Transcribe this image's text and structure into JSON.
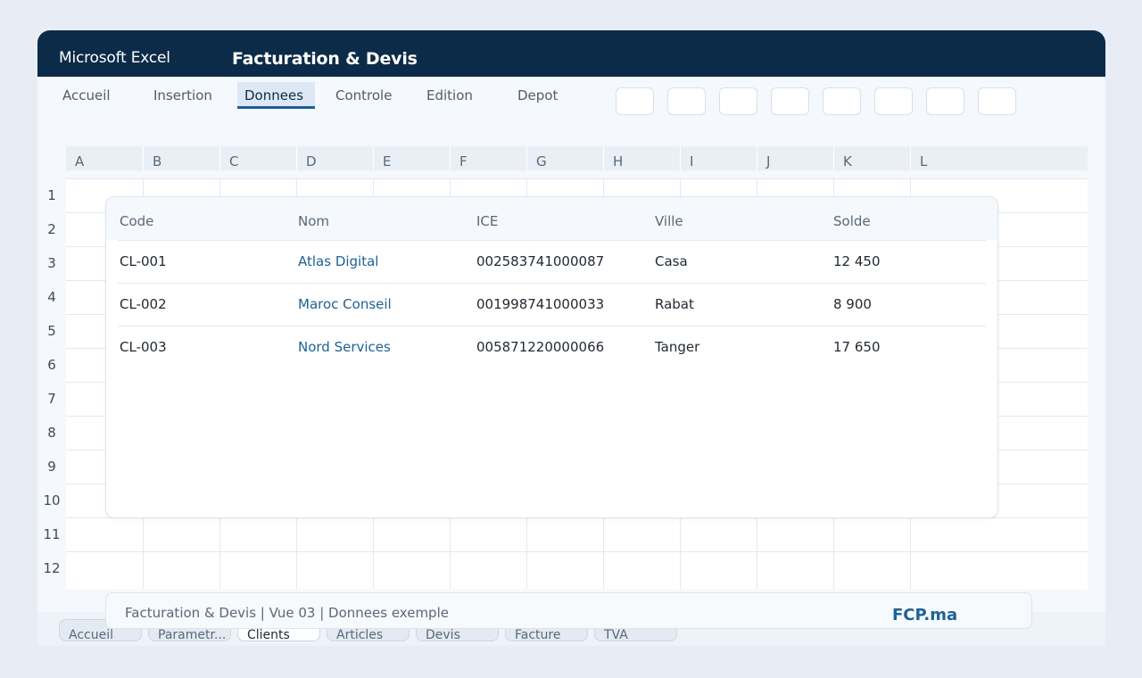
{
  "titlebar": {
    "app_name": "Microsoft Excel",
    "doc_title": "Facturation & Devis"
  },
  "ribbon": {
    "tabs": [
      {
        "label": "Accueil"
      },
      {
        "label": "Insertion"
      },
      {
        "label": "Donnees",
        "active": true
      },
      {
        "label": "Controle"
      },
      {
        "label": "Edition"
      },
      {
        "label": "Depot"
      }
    ],
    "button_count": 8
  },
  "sheet": {
    "columns": [
      "A",
      "B",
      "C",
      "D",
      "E",
      "F",
      "G",
      "H",
      "I",
      "J",
      "K",
      "L"
    ],
    "rows": [
      "1",
      "2",
      "3",
      "4",
      "5",
      "6",
      "7",
      "8",
      "9",
      "10",
      "11",
      "12"
    ]
  },
  "clients_table": {
    "headers": [
      "Code",
      "Nom",
      "ICE",
      "Ville",
      "Solde"
    ],
    "rows": [
      {
        "code": "CL-001",
        "nom": "Atlas Digital",
        "ice": "002583741000087",
        "ville": "Casa",
        "solde": "12 450"
      },
      {
        "code": "CL-002",
        "nom": "Maroc Conseil",
        "ice": "001998741000033",
        "ville": "Rabat",
        "solde": "8 900"
      },
      {
        "code": "CL-003",
        "nom": "Nord Services",
        "ice": "005871220000066",
        "ville": "Tanger",
        "solde": "17 650"
      }
    ]
  },
  "footer": {
    "text": "Facturation & Devis | Vue 03 | Donnees exemple",
    "brand": "FCP.ma"
  },
  "sheet_tabs": [
    {
      "label": "Accueil"
    },
    {
      "label": "Parametr..."
    },
    {
      "label": "Clients",
      "active": true
    },
    {
      "label": "Articles"
    },
    {
      "label": "Devis"
    },
    {
      "label": "Facture"
    },
    {
      "label": "TVA"
    }
  ],
  "colors": {
    "titlebar": "#0c2b48",
    "accent": "#1d5f96",
    "link": "#1d6296",
    "brand": "#1d6296"
  }
}
